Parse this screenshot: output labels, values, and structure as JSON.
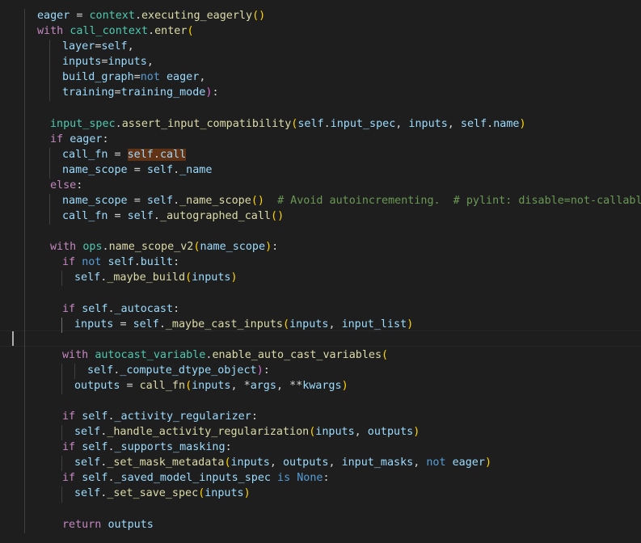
{
  "editor": {
    "language": "python",
    "theme": "dark",
    "colors": {
      "background": "#1e1e1e",
      "control_keyword": "#c586c0",
      "keyword": "#569cd6",
      "variable": "#9cdcfe",
      "function": "#dcdcaa",
      "module": "#4ec9b0",
      "comment": "#6a9955",
      "bracket_level1": "#ffd700",
      "bracket_level2": "#da70d6",
      "highlight": "#613214"
    },
    "lines": [
      {
        "text": "eager = context.executing_eagerly()"
      },
      {
        "text": "with call_context.enter("
      },
      {
        "text": "layer=self,"
      },
      {
        "text": "inputs=inputs,"
      },
      {
        "text": "build_graph=not eager,"
      },
      {
        "text": "training=training_mode):"
      },
      {
        "text": ""
      },
      {
        "text": "input_spec.assert_input_compatibility(self.input_spec, inputs, self.name)"
      },
      {
        "text": "if eager:"
      },
      {
        "text": "call_fn = self.call"
      },
      {
        "text": "name_scope = self._name"
      },
      {
        "text": "else:"
      },
      {
        "text": "name_scope = self._name_scope()  # Avoid autoincrementing.  # pylint: disable=not-callable"
      },
      {
        "text": "call_fn = self._autographed_call()"
      },
      {
        "text": ""
      },
      {
        "text": "with ops.name_scope_v2(name_scope):"
      },
      {
        "text": "if not self.built:"
      },
      {
        "text": "self._maybe_build(inputs)"
      },
      {
        "text": ""
      },
      {
        "text": "if self._autocast:"
      },
      {
        "text": "inputs = self._maybe_cast_inputs(inputs, input_list)"
      },
      {
        "text": ""
      },
      {
        "text": "with autocast_variable.enable_auto_cast_variables("
      },
      {
        "text": "self._compute_dtype_object):"
      },
      {
        "text": "outputs = call_fn(inputs, *args, **kwargs)"
      },
      {
        "text": ""
      },
      {
        "text": "if self._activity_regularizer:"
      },
      {
        "text": "self._handle_activity_regularization(inputs, outputs)"
      },
      {
        "text": "if self._supports_masking:"
      },
      {
        "text": "self._set_mask_metadata(inputs, outputs, input_masks, not eager)"
      },
      {
        "text": "if self._saved_model_inputs_spec is None:"
      },
      {
        "text": "self._set_save_spec(inputs)"
      },
      {
        "text": ""
      },
      {
        "text": "return outputs"
      }
    ]
  }
}
